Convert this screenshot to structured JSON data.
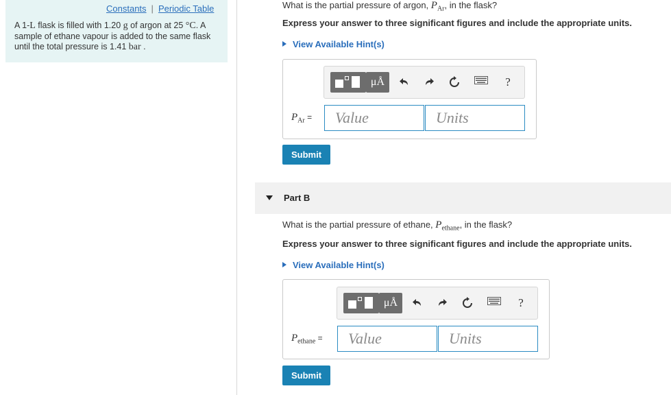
{
  "left": {
    "constants_link": "Constants",
    "separator": "|",
    "periodic_link": "Periodic Table",
    "problem_parts": [
      "A 1-",
      "L",
      " flask is filled with 1.20 ",
      "g",
      " of argon at 25 ",
      "°C",
      ". A sample of ethane vapour is added to the same flask until the total pressure is 1.41 ",
      "bar",
      " ."
    ]
  },
  "partA": {
    "question_pre": "What is the partial pressure of argon, ",
    "var_main": "P",
    "var_sub": "Ar",
    "question_post": ", in the flask?",
    "express": "Express your answer to three significant figures and include the appropriate units.",
    "hint": "View Available Hint(s)",
    "answer_var": "P",
    "answer_sub": "Ar",
    "answer_eq": " =",
    "value_placeholder": "Value",
    "units_placeholder": "Units",
    "submit": "Submit"
  },
  "partB": {
    "title": "Part B",
    "question_pre": "What is the partial pressure of ethane, ",
    "var_main": "P",
    "var_sub": "ethane",
    "question_post": ", in the flask?",
    "express": "Express your answer to three significant figures and include the appropriate units.",
    "hint": "View Available Hint(s)",
    "answer_var": "P",
    "answer_sub": "ethane",
    "answer_eq": " =",
    "value_placeholder": "Value",
    "units_placeholder": "Units",
    "submit": "Submit"
  },
  "toolbar": {
    "units_glyph": "μÅ",
    "help_glyph": "?",
    "icons": [
      "templates-icon",
      "units-icon",
      "undo-icon",
      "redo-icon",
      "reset-icon",
      "keyboard-icon",
      "help-icon"
    ]
  },
  "colors": {
    "link": "#2a6ebb",
    "panel_bg": "#e6f4f4",
    "submit_bg": "#1a82b4",
    "input_border": "#2a8bc2"
  }
}
